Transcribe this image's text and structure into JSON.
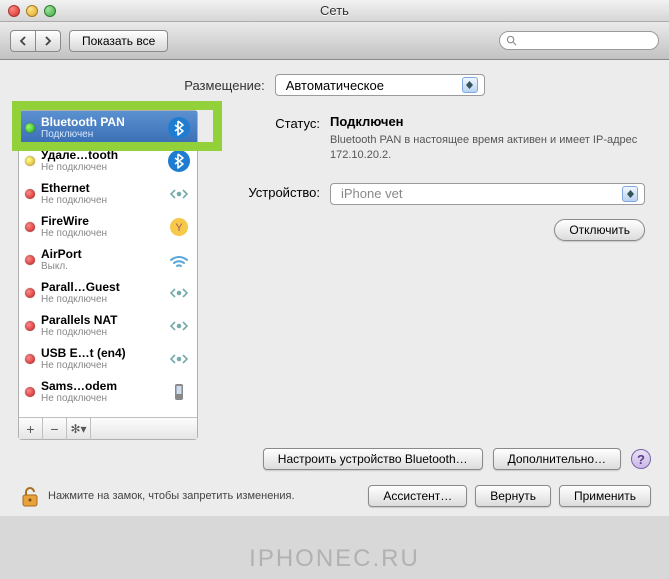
{
  "titlebar": {
    "title": "Сеть"
  },
  "toolbar": {
    "show_all": "Показать все",
    "search_placeholder": ""
  },
  "location": {
    "label": "Размещение:",
    "value": "Автоматическое"
  },
  "sidebar": {
    "items": [
      {
        "name": "Bluetooth PAN",
        "status": "Подключен",
        "dot": "green",
        "icon": "bluetooth",
        "selected": true
      },
      {
        "name": "Удале…tooth",
        "status": "Не подключен",
        "dot": "yellow",
        "icon": "bluetooth"
      },
      {
        "name": "Ethernet",
        "status": "Не подключен",
        "dot": "red",
        "icon": "eth"
      },
      {
        "name": "FireWire",
        "status": "Не подключен",
        "dot": "red",
        "icon": "firewire"
      },
      {
        "name": "AirPort",
        "status": "Выкл.",
        "dot": "red",
        "icon": "wifi"
      },
      {
        "name": "Parall…Guest",
        "status": "Не подключен",
        "dot": "red",
        "icon": "eth"
      },
      {
        "name": "Parallels NAT",
        "status": "Не подключен",
        "dot": "red",
        "icon": "eth"
      },
      {
        "name": "USB E…t (en4)",
        "status": "Не подключен",
        "dot": "red",
        "icon": "eth"
      },
      {
        "name": "Sams…odem",
        "status": "Не подключен",
        "dot": "red",
        "icon": "phone"
      }
    ],
    "footer": {
      "add": "+",
      "remove": "−",
      "gear": "⚙"
    }
  },
  "detail": {
    "status_label": "Статус:",
    "status_value": "Подключен",
    "status_desc": "Bluetooth PAN в настоящее время активен и имеет IP-адрес 172.10.20.2.",
    "device_label": "Устройство:",
    "device_value": "iPhone vet",
    "disconnect": "Отключить",
    "configure_bt": "Настроить устройство Bluetooth…",
    "advanced": "Дополнительно…",
    "help": "?"
  },
  "lockbar": {
    "text": "Нажмите на замок, чтобы запретить изменения.",
    "assistant": "Ассистент…",
    "revert": "Вернуть",
    "apply": "Применить"
  },
  "watermark": "IPHONEC.RU"
}
